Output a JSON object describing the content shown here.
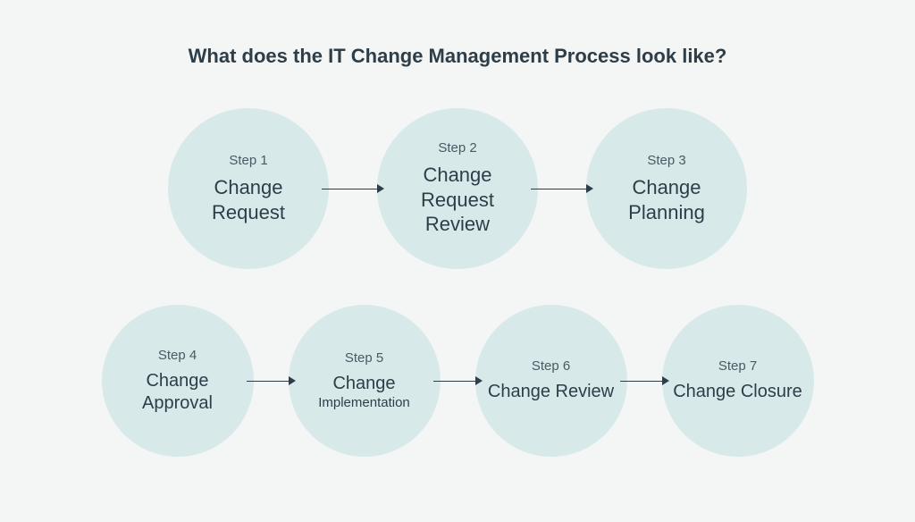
{
  "title": "What does the IT Change Management Process look like?",
  "row1": [
    {
      "step": "Step 1",
      "title": "Change Request"
    },
    {
      "step": "Step 2",
      "title": "Change Request Review"
    },
    {
      "step": "Step 3",
      "title": "Change Planning"
    }
  ],
  "row2": [
    {
      "step": "Step 4",
      "title": "Change Approval"
    },
    {
      "step": "Step 5",
      "title_line1": "Change",
      "title_line2": "Implementation"
    },
    {
      "step": "Step 6",
      "title": "Change Review"
    },
    {
      "step": "Step 7",
      "title": "Change Closure"
    }
  ]
}
